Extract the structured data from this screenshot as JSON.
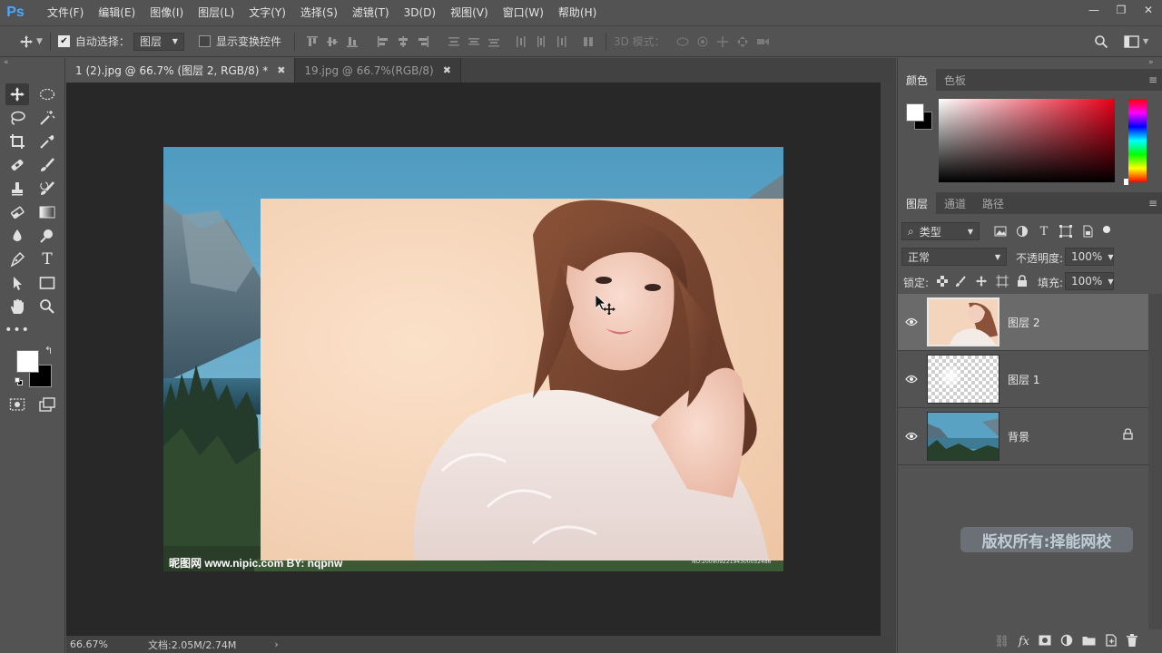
{
  "app": {
    "logo": "Ps"
  },
  "menu": [
    "文件(F)",
    "编辑(E)",
    "图像(I)",
    "图层(L)",
    "文字(Y)",
    "选择(S)",
    "滤镜(T)",
    "3D(D)",
    "视图(V)",
    "窗口(W)",
    "帮助(H)"
  ],
  "options": {
    "auto_select_label": "自动选择：",
    "auto_select_checked": true,
    "auto_select_target": "图层",
    "show_transform_label": "显示变换控件",
    "show_transform_checked": false,
    "mode_3d_label": "3D 模式："
  },
  "tabs": [
    {
      "label": "1 (2).jpg @ 66.7% (图层 2, RGB/8) *",
      "active": true
    },
    {
      "label": "19.jpg @ 66.7%(RGB/8)",
      "active": false
    }
  ],
  "canvas": {
    "watermark_left": "昵图网 www.nipic.com   BY: nqpnw",
    "watermark_right": "NO:20090922194300052486"
  },
  "status": {
    "zoom": "66.67%",
    "doc_info": "文档:2.05M/2.74M"
  },
  "color_panel": {
    "tabs": [
      "颜色",
      "色板"
    ],
    "foreground": "#ffffff",
    "background": "#000000"
  },
  "layers_panel": {
    "tabs": [
      "图层",
      "通道",
      "路径"
    ],
    "filter_kind": "类型",
    "blend_mode": "正常",
    "opacity_label": "不透明度:",
    "opacity_value": "100%",
    "lock_label": "锁定:",
    "fill_label": "填充:",
    "fill_value": "100%",
    "layers": [
      {
        "name": "图层 2",
        "visible": true,
        "selected": true,
        "locked": false
      },
      {
        "name": "图层 1",
        "visible": true,
        "selected": false,
        "locked": false
      },
      {
        "name": "背景",
        "visible": true,
        "selected": false,
        "locked": true
      }
    ]
  },
  "copyright_overlay": "版权所有:择能网校"
}
